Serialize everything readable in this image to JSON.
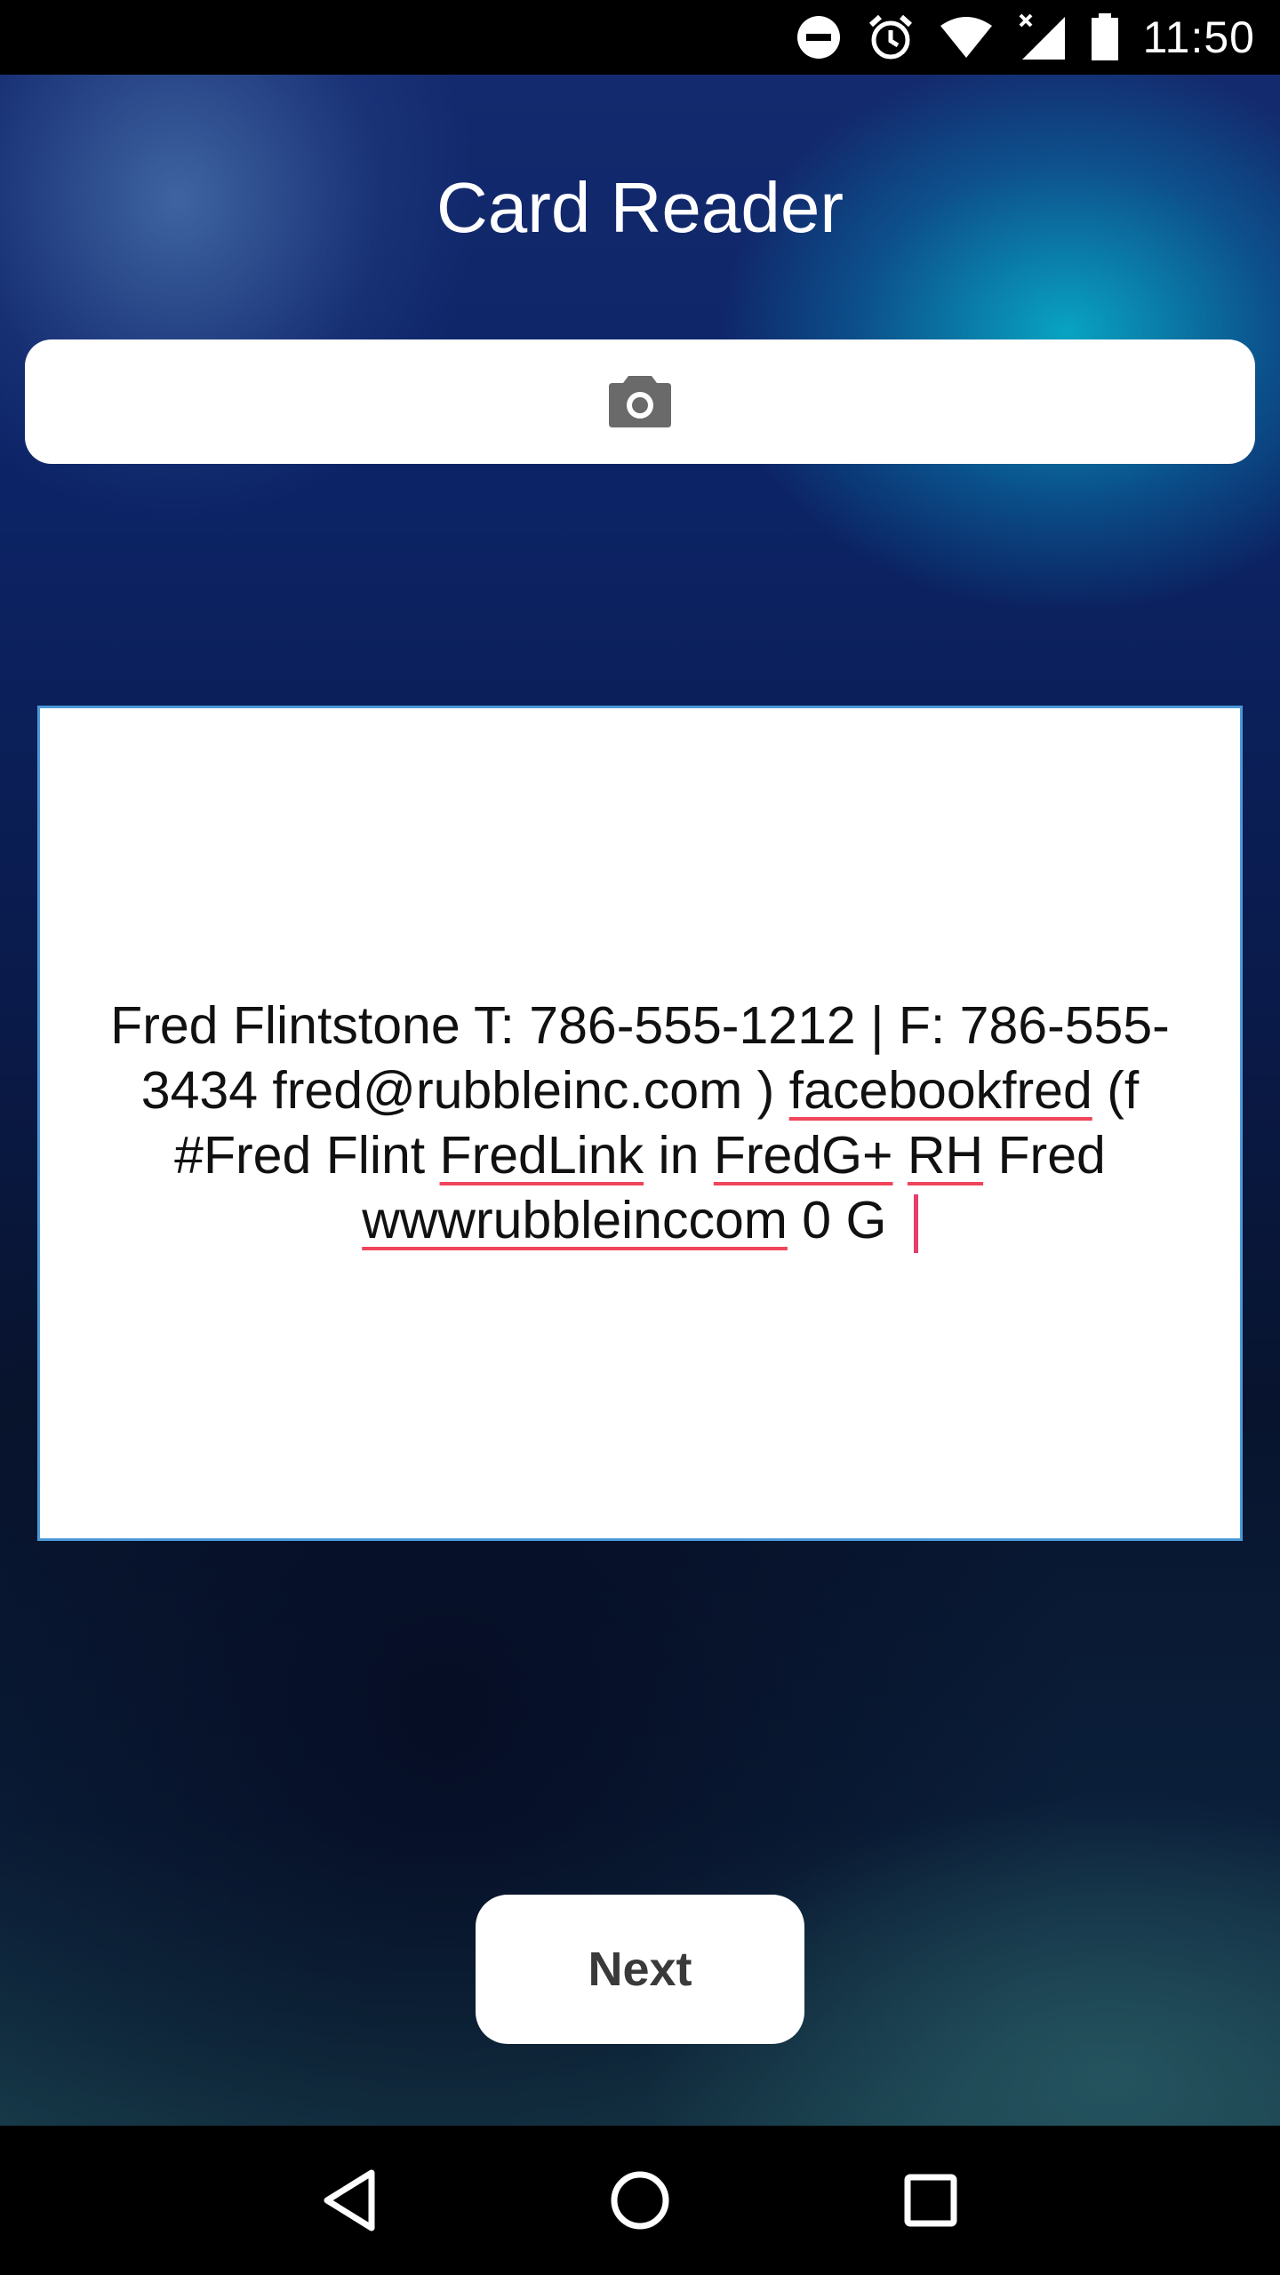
{
  "status_bar": {
    "time": "11:50",
    "icons": [
      "do-not-disturb-icon",
      "alarm-icon",
      "wifi-icon",
      "signal-no-data-icon",
      "battery-icon"
    ]
  },
  "app": {
    "title": "Card Reader",
    "camera_button_icon": "camera-icon",
    "ocr_text_segments": [
      {
        "text": "Fred Flintstone T: 786-555-1212 | F: 786-555-3434 fred@rubbleinc.com ) ",
        "misspelled": false
      },
      {
        "text": "facebookfred",
        "misspelled": true
      },
      {
        "text": " (f #Fred Flint ",
        "misspelled": false
      },
      {
        "text": "FredLink",
        "misspelled": true
      },
      {
        "text": " in ",
        "misspelled": false
      },
      {
        "text": "FredG+",
        "misspelled": true
      },
      {
        "text": " ",
        "misspelled": false
      },
      {
        "text": "RH",
        "misspelled": true
      },
      {
        "text": " Fred ",
        "misspelled": false
      },
      {
        "text": "wwwrubbleinccom",
        "misspelled": true
      },
      {
        "text": " 0 G ",
        "misspelled": false
      }
    ],
    "next_label": "Next"
  },
  "nav_bar": {
    "buttons": [
      "back-icon",
      "home-icon",
      "recents-icon"
    ]
  },
  "colors": {
    "spellcheck_underline": "#f0455a",
    "cursor": "#e83c6a",
    "text_area_border": "#4b9ad8"
  }
}
